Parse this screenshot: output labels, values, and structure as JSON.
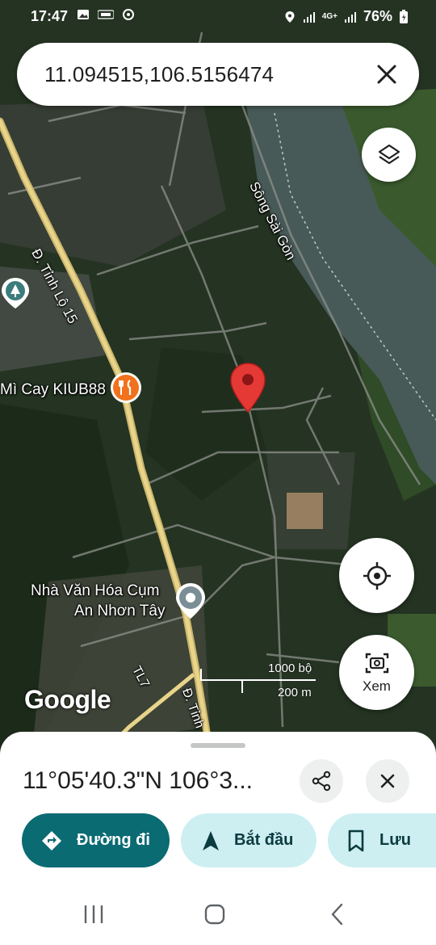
{
  "status_bar": {
    "time": "17:47",
    "left_icons": [
      "gallery-icon",
      "tot-icon",
      "sync-icon"
    ],
    "right_icons": [
      "location-icon",
      "signal-icon",
      "4g-icon",
      "signal-icon-2",
      "battery-icon"
    ],
    "network": "4G+",
    "battery": "76%"
  },
  "search": {
    "value": "11.094515,106.5156474",
    "close_icon": "close-icon"
  },
  "map": {
    "labels": {
      "river": "Sông Sài Gòn",
      "road_tl15": "Đ. Tỉnh Lộ 15",
      "restaurant": "Mì Cay KIUB88",
      "cultural_house_line1": "Nhà Văn Hóa Cụm",
      "cultural_house_line2": "An Nhơn Tây",
      "tl7": "TL7",
      "road_bottom": "Đ. Tỉnh"
    },
    "scale": {
      "top": "1000 bộ",
      "bottom": "200 m"
    },
    "logo": "Google",
    "xem_label": "Xem"
  },
  "sheet": {
    "coords": "11°05'40.3\"N 106°3...",
    "directions_label": "Đường đi",
    "start_label": "Bắt đầu",
    "save_label": "Lưu"
  },
  "colors": {
    "accent": "#0b6b72",
    "chip_light": "#cdeff2",
    "pin": "#e53935",
    "restaurant_pin": "#f2711c",
    "road_major": "#e8d48a"
  }
}
